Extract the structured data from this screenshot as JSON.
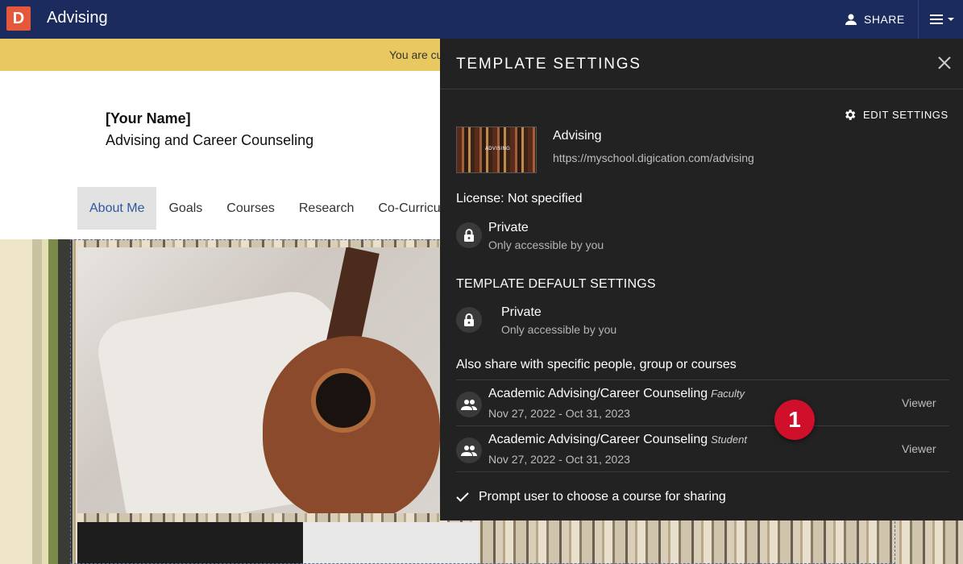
{
  "topbar": {
    "logo_letter": "D",
    "app_title": "Advising",
    "share_label": "SHARE"
  },
  "banner": {
    "text": "You are cu"
  },
  "portfolio": {
    "name": "[Your Name]",
    "subtitle": "Advising and Career Counseling",
    "nav": [
      "About Me",
      "Goals",
      "Courses",
      "Research",
      "Co-Curricu"
    ],
    "active_nav": "About Me"
  },
  "panel": {
    "title": "TEMPLATE SETTINGS",
    "edit_settings_label": "EDIT SETTINGS",
    "thumbnail_label": "ADVISING",
    "template_name": "Advising",
    "template_url": "https://myschool.digication.com/advising",
    "license": "License: Not specified",
    "privacy": {
      "title": "Private",
      "subtitle": "Only accessible by you"
    },
    "default_section_heading": "TEMPLATE DEFAULT SETTINGS",
    "default_privacy": {
      "title": "Private",
      "subtitle": "Only accessible by you"
    },
    "also_share_heading": "Also share with specific people, group or courses",
    "shares": [
      {
        "name": "Academic Advising/Career Counseling",
        "role": "Faculty",
        "dates": "Nov 27, 2022 - Oct 31, 2023",
        "permission": "Viewer"
      },
      {
        "name": "Academic Advising/Career Counseling",
        "role": "Student",
        "dates": "Nov 27, 2022 - Oct 31, 2023",
        "permission": "Viewer"
      }
    ],
    "prompt_label": "Prompt user to choose a course for sharing",
    "prompt_checked": true
  },
  "callout_badge": "1",
  "colors": {
    "topbar": "#1b2b5e",
    "banner": "#e9c95f",
    "panel": "#222222",
    "badge": "#d0102a",
    "active_nav_text": "#2d5aa0"
  }
}
